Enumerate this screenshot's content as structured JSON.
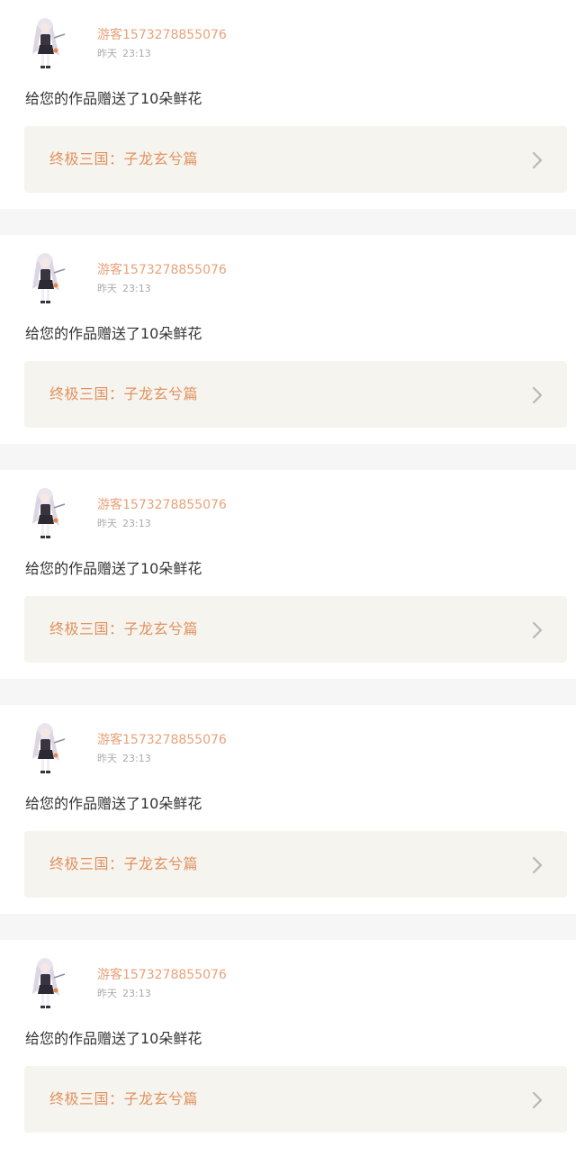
{
  "feed": {
    "items": [
      {
        "username": "游客1573278855076",
        "day": "昨天",
        "time": "23:13",
        "message": "给您的作品赠送了10朵鲜花",
        "work_title": "终极三国：子龙玄兮篇",
        "avatar_icon": "anime-girl-avatar-icon",
        "chevron_icon": "chevron-right-icon"
      },
      {
        "username": "游客1573278855076",
        "day": "昨天",
        "time": "23:13",
        "message": "给您的作品赠送了10朵鲜花",
        "work_title": "终极三国：子龙玄兮篇",
        "avatar_icon": "anime-girl-avatar-icon",
        "chevron_icon": "chevron-right-icon"
      },
      {
        "username": "游客1573278855076",
        "day": "昨天",
        "time": "23:13",
        "message": "给您的作品赠送了10朵鲜花",
        "work_title": "终极三国：子龙玄兮篇",
        "avatar_icon": "anime-girl-avatar-icon",
        "chevron_icon": "chevron-right-icon"
      },
      {
        "username": "游客1573278855076",
        "day": "昨天",
        "time": "23:13",
        "message": "给您的作品赠送了10朵鲜花",
        "work_title": "终极三国：子龙玄兮篇",
        "avatar_icon": "anime-girl-avatar-icon",
        "chevron_icon": "chevron-right-icon"
      },
      {
        "username": "游客1573278855076",
        "day": "昨天",
        "time": "23:13",
        "message": "给您的作品赠送了10朵鲜花",
        "work_title": "终极三国：子龙玄兮篇",
        "avatar_icon": "anime-girl-avatar-icon",
        "chevron_icon": "chevron-right-icon"
      }
    ]
  },
  "colors": {
    "username": "#e8a27a",
    "work_title": "#e2915e",
    "link_background": "#f5f4ee",
    "separator": "#f6f6f6"
  }
}
